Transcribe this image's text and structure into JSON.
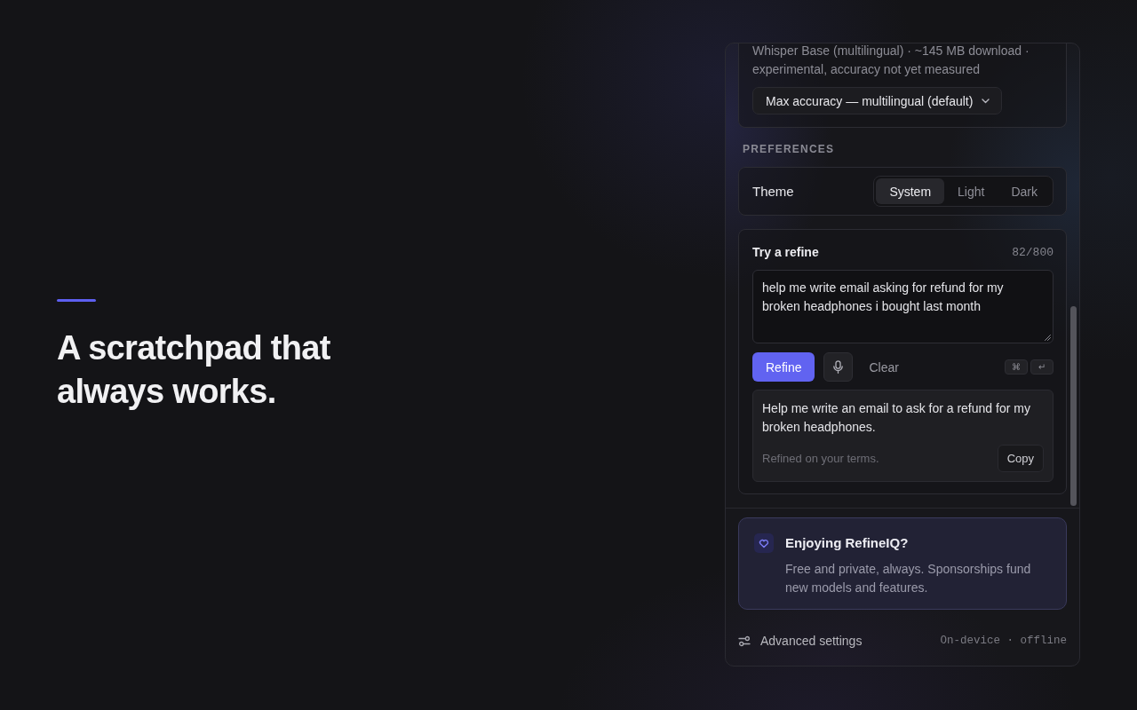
{
  "hero": {
    "headline": "A scratchpad that always works."
  },
  "model_card": {
    "description": "Whisper Base (multilingual) · ~145 MB download · experimental, accuracy not yet measured",
    "model_select": {
      "value": "Max accuracy — multilingual (default)"
    }
  },
  "preferences": {
    "heading": "PREFERENCES",
    "theme": {
      "label": "Theme",
      "options": [
        {
          "label": "System",
          "selected": true
        },
        {
          "label": "Light",
          "selected": false
        },
        {
          "label": "Dark",
          "selected": false
        }
      ]
    }
  },
  "refine": {
    "title": "Try a refine",
    "counter": "82/800",
    "input": {
      "value": "help me write email asking for refund for my broken headphones i bought last month"
    },
    "refine_button": "Refine",
    "clear_button": "Clear",
    "shortcut_keys": [
      "⌘",
      "↵"
    ],
    "output": {
      "text": "Help me write an email to ask for a refund for my broken headphones.",
      "note": "Refined on your terms.",
      "copy_button": "Copy"
    }
  },
  "sponsor": {
    "title": "Enjoying RefineIQ?",
    "body": "Free and private, always. Sponsorships fund new models and features."
  },
  "footer": {
    "advanced_settings": "Advanced settings",
    "status": "On-device · offline"
  }
}
